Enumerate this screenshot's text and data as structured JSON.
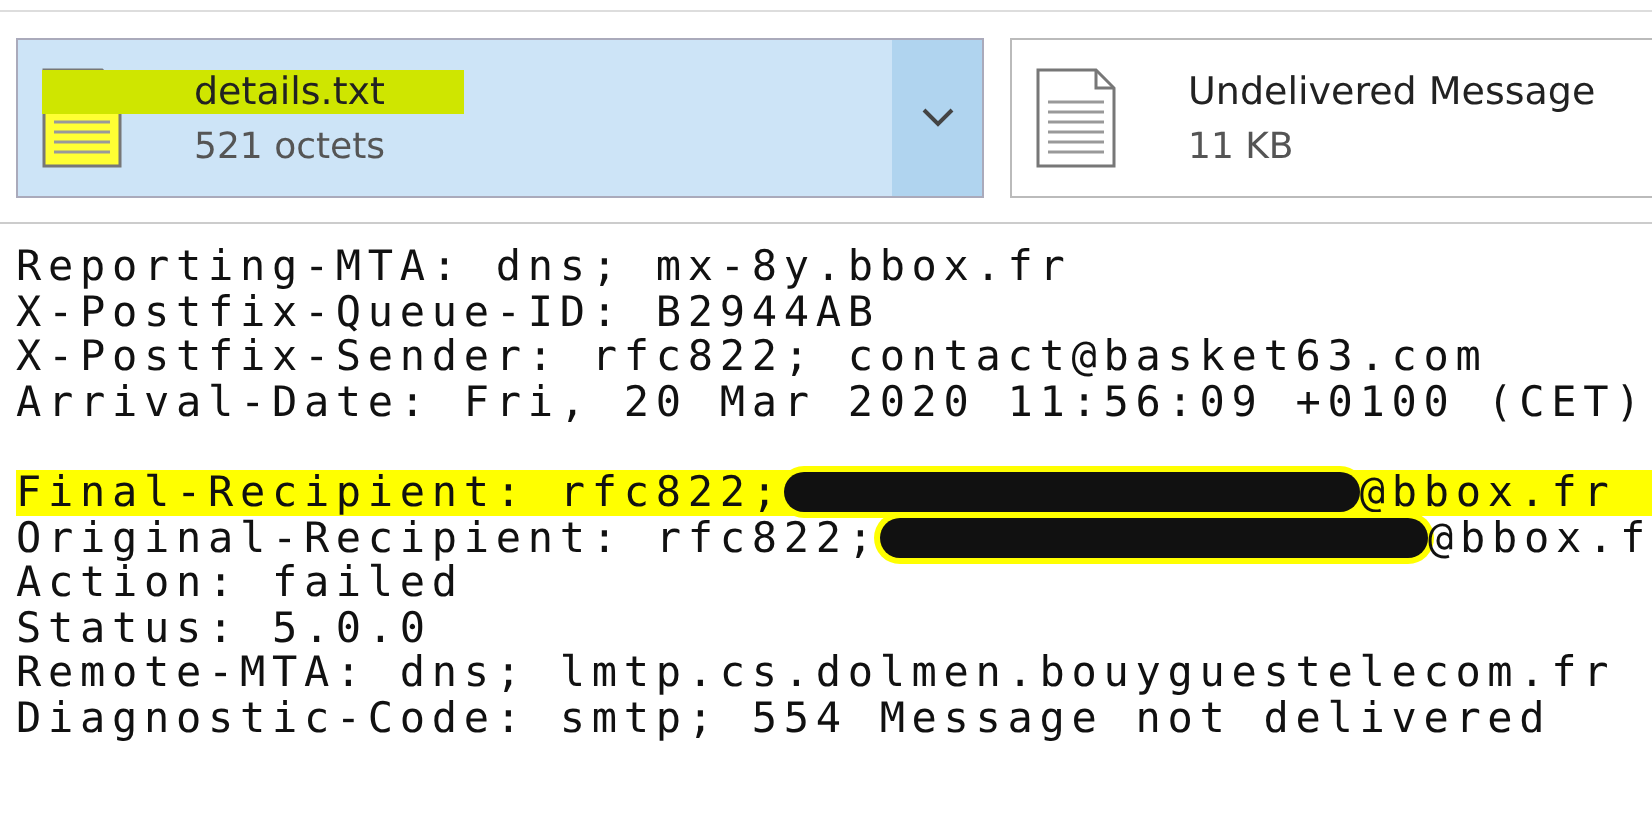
{
  "attachments": [
    {
      "name": "details.txt",
      "size": "521 octets",
      "selected": true,
      "name_highlighted": true,
      "kind": "highlighted-file"
    },
    {
      "name": "Undelivered Message",
      "size": "11 KB",
      "selected": false,
      "name_highlighted": false,
      "kind": "file"
    }
  ],
  "body_lines": [
    {
      "kind": "text",
      "text": "Reporting-MTA: dns; mx-8y.bbox.fr",
      "highlighted": false
    },
    {
      "kind": "text",
      "text": "X-Postfix-Queue-ID: B2944AB",
      "highlighted": false
    },
    {
      "kind": "text",
      "text": "X-Postfix-Sender: rfc822; contact@basket63.com",
      "highlighted": false
    },
    {
      "kind": "text",
      "text": "Arrival-Date: Fri, 20 Mar 2020 11:56:09 +0100 (CET)",
      "highlighted": false
    },
    {
      "kind": "blank"
    },
    {
      "kind": "redacted",
      "before": "Final-Recipient: rfc822;",
      "after": "@bbox.fr",
      "highlighted": true,
      "blot_highlighted": true
    },
    {
      "kind": "redacted",
      "before": "Original-Recipient: rfc822;",
      "after": "@bbox.f",
      "highlighted": false,
      "blot_highlighted": true
    },
    {
      "kind": "text",
      "text": "Action: failed",
      "highlighted": false
    },
    {
      "kind": "text",
      "text": "Status: 5.0.0",
      "highlighted": false
    },
    {
      "kind": "text",
      "text": "Remote-MTA: dns; lmtp.cs.dolmen.bouyguestelecom.fr",
      "highlighted": false
    },
    {
      "kind": "text",
      "text": "Diagnostic-Code: smtp; 554 Message not delivered",
      "highlighted": false
    }
  ]
}
